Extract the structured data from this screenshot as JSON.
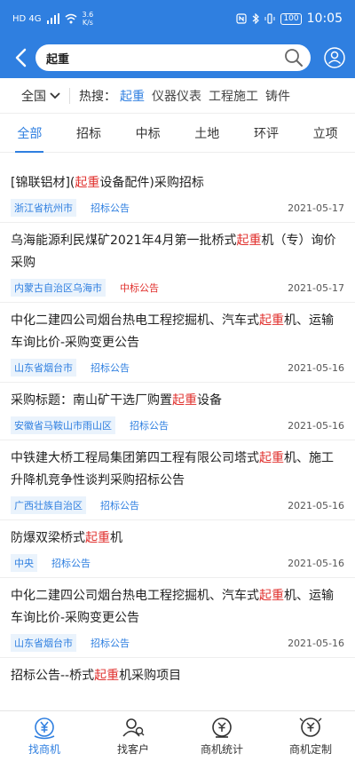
{
  "statusbar": {
    "signal_text": "HD 4G",
    "speed": "3.6",
    "speed_unit": "K/s",
    "battery": "100",
    "time": "10:05"
  },
  "search": {
    "value": "起重"
  },
  "hot": {
    "region": "全国",
    "label": "热搜：",
    "items": [
      "起重",
      "仪器仪表",
      "工程施工",
      "铸件"
    ]
  },
  "tabs": [
    "全部",
    "招标",
    "中标",
    "土地",
    "环评",
    "立项"
  ],
  "list": [
    {
      "pre": "[锦联铝材](",
      "hl": "起重",
      "post": "设备配件)采购招标",
      "loc": "浙江省杭州市",
      "type": "招标公告",
      "date": "2021-05-17"
    },
    {
      "pre": "乌海能源利民煤矿2021年4月第一批桥式",
      "hl": "起重",
      "post": "机（专）询价采购",
      "loc": "内蒙古自治区乌海市",
      "type": "中标公告",
      "date": "2021-05-17"
    },
    {
      "pre": "中化二建四公司烟台热电工程挖掘机、汽车式",
      "hl": "起重",
      "post": "机、运输车询比价-采购变更公告",
      "loc": "山东省烟台市",
      "type": "招标公告",
      "date": "2021-05-16"
    },
    {
      "pre": "采购标题：南山矿干选厂购置",
      "hl": "起重",
      "post": "设备",
      "loc": "安徽省马鞍山市雨山区",
      "type": "招标公告",
      "date": "2021-05-16"
    },
    {
      "pre": "中铁建大桥工程局集团第四工程有限公司塔式",
      "hl": "起重",
      "post": "机、施工升降机竞争性谈判采购招标公告",
      "loc": "广西壮族自治区",
      "type": "招标公告",
      "date": "2021-05-16"
    },
    {
      "pre": "防爆双梁桥式",
      "hl": "起重",
      "post": "机",
      "loc": "中央",
      "type": "招标公告",
      "date": "2021-05-16"
    },
    {
      "pre": "中化二建四公司烟台热电工程挖掘机、汽车式",
      "hl": "起重",
      "post": "机、运输车询比价-采购变更公告",
      "loc": "山东省烟台市",
      "type": "招标公告",
      "date": "2021-05-16"
    },
    {
      "pre": "招标公告--桥式",
      "hl": "起重",
      "post": "机采购项目",
      "loc": "",
      "type": "",
      "date": ""
    }
  ],
  "nav": [
    "找商机",
    "找客户",
    "商机统计",
    "商机定制"
  ],
  "colors": {
    "accent": "#2f7fe0",
    "highlight": "#e0302d"
  }
}
